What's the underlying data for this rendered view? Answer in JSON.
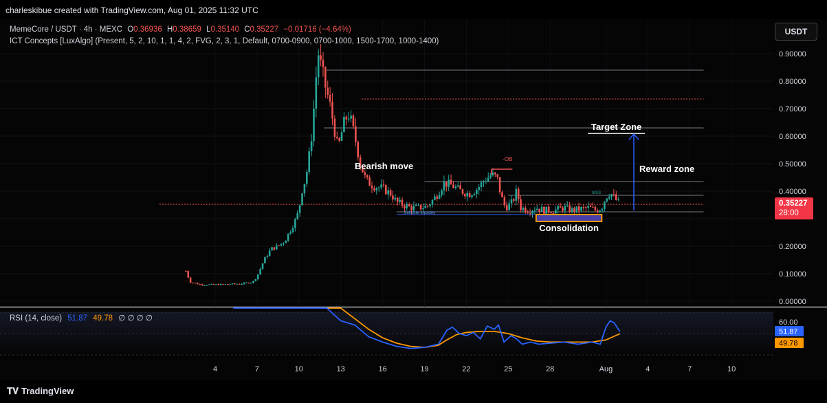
{
  "header": {
    "attribution": "charleskibue created with TradingView.com, Aug 01, 2025 11:32 UTC"
  },
  "legend": {
    "symbol": "MemeCore / USDT · 4h · MEXC",
    "o_label": "O",
    "o": "0.36936",
    "h_label": "H",
    "h": "0.38659",
    "l_label": "L",
    "l": "0.35140",
    "c_label": "C",
    "c": "0.35227",
    "change": "−0.01716 (−4.64%)",
    "indicator": "ICT Concepts [LuxAlgo] (Present, 5, 2, 10, 1, 1, 4, 2, FVG, 2, 3, 1, Default, 0700-0900, 0700-1000, 1500-1700, 1000-1400)"
  },
  "currency_button": "USDT",
  "price_axis": {
    "ticks": [
      "0.90000",
      "0.80000",
      "0.70000",
      "0.60000",
      "0.50000",
      "0.40000",
      "0.20000",
      "0.10000",
      "0.00000"
    ],
    "tick_values": [
      0.9,
      0.8,
      0.7,
      0.6,
      0.5,
      0.4,
      0.2,
      0.1,
      0.0
    ],
    "current_price": "0.35227",
    "countdown": "28:00",
    "current_value": 0.35227
  },
  "rsi": {
    "label": "RSI (14, close)",
    "value": "51.87",
    "ma_value": "49.78",
    "placeholders": "∅ ∅ ∅ ∅",
    "axis_tick": "60.00"
  },
  "time_axis": {
    "labels": [
      "4",
      "7",
      "10",
      "13",
      "16",
      "19",
      "22",
      "25",
      "28",
      "Aug",
      "4",
      "7",
      "10"
    ],
    "day_index": [
      4,
      7,
      10,
      13,
      16,
      19,
      22,
      25,
      28,
      32,
      35,
      38,
      41
    ]
  },
  "annotations": {
    "bearish_move": "Bearish move",
    "target_zone": "Target Zone",
    "reward_zone": "Reward zone",
    "consolidation": "Consolidation",
    "ob_label": "-OB",
    "sellside": "Sellside liquidity",
    "mss": "MSS"
  },
  "footer": {
    "brand": "TradingView"
  },
  "colors": {
    "up": "#26a69a",
    "down": "#ef5350",
    "rsi": "#2962ff",
    "rsi_ma": "#ff9800",
    "arrow": "#2962ff",
    "consolidation_fill": "#4a3fa8",
    "consolidation_border": "#ff9800",
    "price_tag": "#f23645"
  },
  "chart_data": {
    "type": "candlestick",
    "x_unit": "day (July 2025, Aug 1 = 32)",
    "ylim": [
      0,
      0.95
    ],
    "y_ticks": [
      0.0,
      0.1,
      0.2,
      0.3,
      0.4,
      0.5,
      0.6,
      0.7,
      0.8,
      0.9
    ],
    "close_path": [
      [
        1.9,
        0.11
      ],
      [
        2.2,
        0.07
      ],
      [
        3.0,
        0.06
      ],
      [
        4.0,
        0.06
      ],
      [
        5.0,
        0.062
      ],
      [
        6.0,
        0.064
      ],
      [
        6.7,
        0.07
      ],
      [
        7.0,
        0.09
      ],
      [
        7.5,
        0.15
      ],
      [
        8.0,
        0.19
      ],
      [
        8.5,
        0.2
      ],
      [
        9.0,
        0.22
      ],
      [
        9.4,
        0.26
      ],
      [
        9.8,
        0.3
      ],
      [
        10.0,
        0.33
      ],
      [
        10.2,
        0.4
      ],
      [
        10.5,
        0.45
      ],
      [
        10.8,
        0.55
      ],
      [
        11.0,
        0.65
      ],
      [
        11.2,
        0.8
      ],
      [
        11.4,
        0.9
      ],
      [
        11.6,
        0.85
      ],
      [
        11.9,
        0.78
      ],
      [
        12.2,
        0.72
      ],
      [
        12.5,
        0.64
      ],
      [
        12.8,
        0.55
      ],
      [
        13.0,
        0.6
      ],
      [
        13.3,
        0.66
      ],
      [
        13.6,
        0.68
      ],
      [
        14.0,
        0.6
      ],
      [
        14.4,
        0.5
      ],
      [
        14.8,
        0.44
      ],
      [
        15.3,
        0.42
      ],
      [
        16.0,
        0.41
      ],
      [
        16.6,
        0.39
      ],
      [
        17.0,
        0.36
      ],
      [
        17.5,
        0.35
      ],
      [
        18.0,
        0.34
      ],
      [
        18.6,
        0.34
      ],
      [
        19.2,
        0.345
      ],
      [
        19.8,
        0.38
      ],
      [
        20.4,
        0.43
      ],
      [
        21.0,
        0.42
      ],
      [
        21.6,
        0.4
      ],
      [
        22.2,
        0.39
      ],
      [
        22.8,
        0.41
      ],
      [
        23.3,
        0.44
      ],
      [
        23.8,
        0.46
      ],
      [
        24.2,
        0.45
      ],
      [
        24.5,
        0.38
      ],
      [
        24.8,
        0.34
      ],
      [
        25.3,
        0.36
      ],
      [
        25.6,
        0.4
      ],
      [
        25.9,
        0.34
      ],
      [
        26.5,
        0.33
      ],
      [
        27.0,
        0.34
      ],
      [
        27.6,
        0.33
      ],
      [
        28.3,
        0.33
      ],
      [
        29.0,
        0.34
      ],
      [
        29.6,
        0.33
      ],
      [
        30.2,
        0.335
      ],
      [
        30.8,
        0.34
      ],
      [
        31.3,
        0.33
      ],
      [
        31.7,
        0.34
      ],
      [
        32.0,
        0.38
      ],
      [
        32.3,
        0.395
      ],
      [
        32.7,
        0.37
      ],
      [
        33.0,
        0.35227
      ]
    ],
    "rsi_path": [
      [
        5.3,
        80
      ],
      [
        6.0,
        78
      ],
      [
        7.0,
        82
      ],
      [
        12.0,
        76
      ],
      [
        13.0,
        62
      ],
      [
        14.0,
        58
      ],
      [
        15.0,
        47
      ],
      [
        16.0,
        42
      ],
      [
        17.0,
        38
      ],
      [
        18.0,
        36
      ],
      [
        19.0,
        37
      ],
      [
        20.0,
        40
      ],
      [
        20.6,
        53
      ],
      [
        21.0,
        56
      ],
      [
        21.5,
        50
      ],
      [
        22.0,
        48
      ],
      [
        22.5,
        51
      ],
      [
        23.0,
        45
      ],
      [
        23.5,
        57
      ],
      [
        24.0,
        54
      ],
      [
        24.3,
        58
      ],
      [
        24.7,
        42
      ],
      [
        25.2,
        48
      ],
      [
        25.6,
        45
      ],
      [
        26.0,
        40
      ],
      [
        26.6,
        42
      ],
      [
        27.2,
        40
      ],
      [
        28.0,
        41
      ],
      [
        29.0,
        42
      ],
      [
        30.0,
        40
      ],
      [
        31.0,
        42
      ],
      [
        31.6,
        40
      ],
      [
        32.0,
        56
      ],
      [
        32.3,
        62
      ],
      [
        32.6,
        60
      ],
      [
        33.0,
        51.87
      ]
    ],
    "rsi_ma_path": [
      [
        12.0,
        85
      ],
      [
        13.0,
        75
      ],
      [
        14.0,
        64
      ],
      [
        15.0,
        54
      ],
      [
        16.0,
        46
      ],
      [
        17.0,
        41
      ],
      [
        18.0,
        38
      ],
      [
        19.0,
        37
      ],
      [
        20.0,
        39
      ],
      [
        20.6,
        44
      ],
      [
        21.3,
        49
      ],
      [
        22.0,
        51
      ],
      [
        23.0,
        52
      ],
      [
        24.0,
        52
      ],
      [
        25.0,
        50
      ],
      [
        26.0,
        46
      ],
      [
        27.0,
        43
      ],
      [
        28.0,
        42
      ],
      [
        29.0,
        42
      ],
      [
        30.0,
        42
      ],
      [
        31.0,
        42
      ],
      [
        32.0,
        44
      ],
      [
        33.0,
        49.78
      ]
    ],
    "rsi_ylim": [
      30,
      70
    ],
    "levels": [
      {
        "price": 0.84,
        "from": 12.0,
        "to": 39.0,
        "style": "solid",
        "color": "#787b86"
      },
      {
        "price": 0.735,
        "from": 14.5,
        "to": 39.0,
        "style": "dotted",
        "color": "#ef5350"
      },
      {
        "price": 0.63,
        "from": 11.8,
        "to": 39.0,
        "style": "solid",
        "color": "#787b86"
      },
      {
        "price": 0.435,
        "from": 19.0,
        "to": 39.0,
        "style": "solid",
        "color": "#787b86"
      },
      {
        "price": 0.385,
        "from": 25.0,
        "to": 39.0,
        "style": "solid",
        "color": "#787b86"
      },
      {
        "price": 0.35227,
        "from": 0.0,
        "to": 39.0,
        "style": "dotted",
        "color": "#ef5350"
      },
      {
        "price": 0.325,
        "from": 17.0,
        "to": 39.0,
        "style": "solid",
        "color": "#787b86"
      },
      {
        "price": 0.315,
        "from": 17.0,
        "to": 28.5,
        "style": "solid",
        "color": "#2962ff"
      }
    ],
    "ob_level": {
      "price": 0.48,
      "from": 23.8,
      "to": 25.3
    },
    "target_level": {
      "price": 0.61,
      "from": 30.7,
      "to": 34.8
    },
    "consolidation_box": {
      "top": 0.315,
      "bottom": 0.29,
      "from": 27.0,
      "to": 31.7
    },
    "arrow": {
      "x": 34.0,
      "from": 0.33,
      "to": 0.61
    }
  }
}
